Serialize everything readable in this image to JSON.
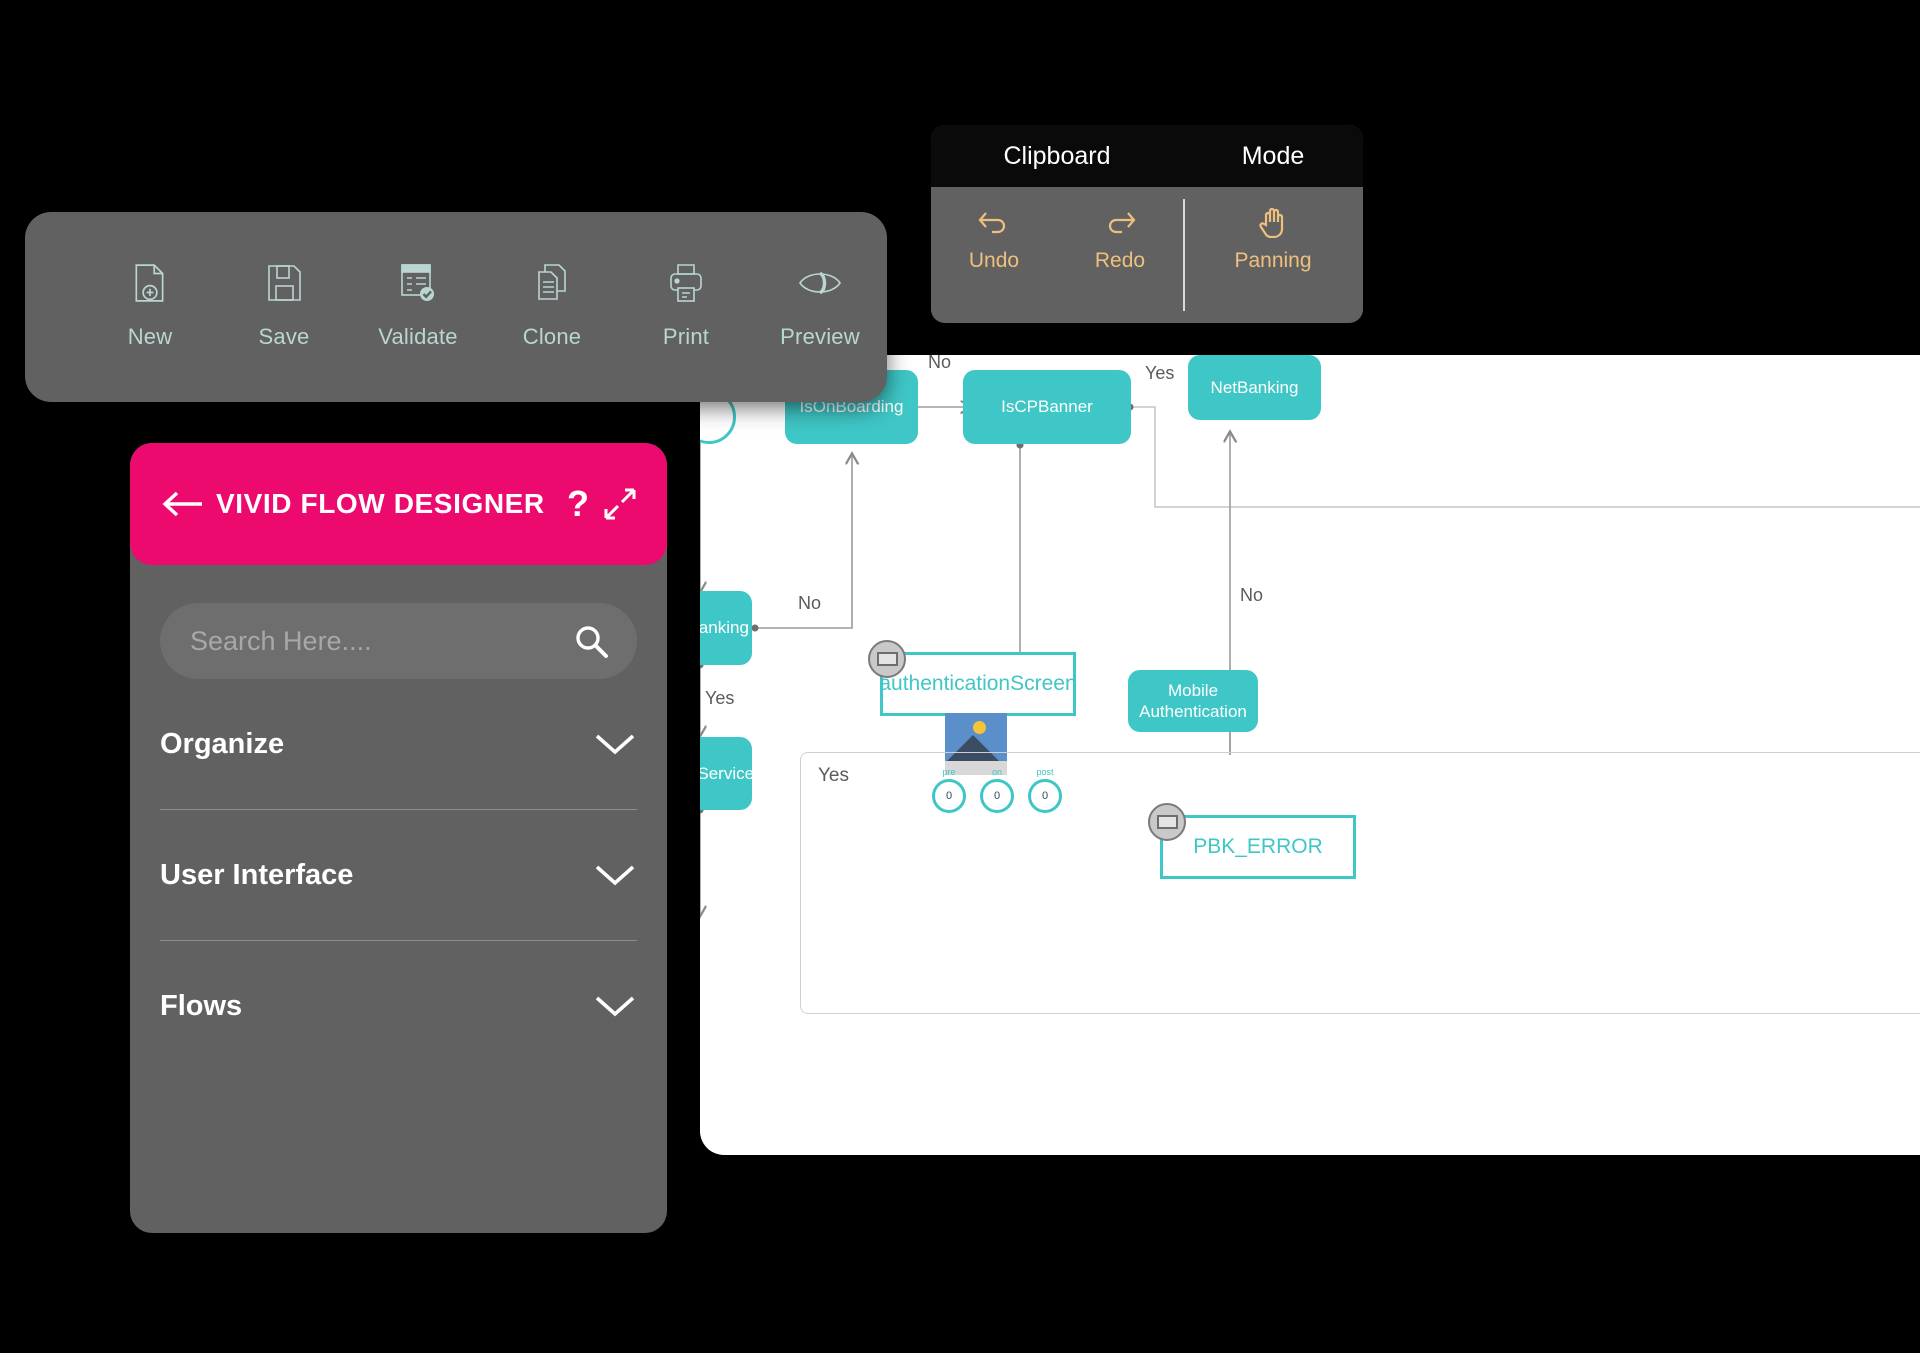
{
  "toolbar": {
    "items": [
      {
        "label": "New",
        "icon": "new-file-icon"
      },
      {
        "label": "Save",
        "icon": "floppy-disk-icon"
      },
      {
        "label": "Validate",
        "icon": "validate-document-icon"
      },
      {
        "label": "Clone",
        "icon": "copy-pages-icon"
      },
      {
        "label": "Print",
        "icon": "printer-icon"
      },
      {
        "label": "Preview",
        "icon": "eye-icon"
      }
    ],
    "icon_color": "#b9d6d2",
    "background": "#616161"
  },
  "clipboard_panel": {
    "groups": [
      {
        "title": "Clipboard"
      },
      {
        "title": "Mode"
      }
    ],
    "clipboard_actions": [
      {
        "label": "Undo",
        "icon": "undo-arrow-icon"
      },
      {
        "label": "Redo",
        "icon": "redo-arrow-icon"
      }
    ],
    "mode_actions": [
      {
        "label": "Panning",
        "icon": "hand-icon"
      }
    ],
    "accent": "#efc07d",
    "header_background": "#0a0a0a",
    "body_background": "#616161"
  },
  "sidebar": {
    "title": "VIVID FLOW DESIGNER",
    "back_icon": "back-arrow-icon",
    "help_icon": "question-mark-icon",
    "expand_icon": "expand-diagonal-icon",
    "header_color": "#ec0a6e",
    "search": {
      "placeholder": "Search Here....",
      "value": "",
      "icon": "search-icon"
    },
    "sections": [
      {
        "label": "Organize",
        "chevron": "chevron-down-icon"
      },
      {
        "label": "User Interface",
        "chevron": "chevron-down-icon"
      },
      {
        "label": "Flows",
        "chevron": "chevron-down-icon"
      }
    ]
  },
  "canvas": {
    "background": "#ffffff",
    "node_color": "#3fc6c6",
    "nodes": [
      {
        "id": "start",
        "label": "",
        "type": "start-circle"
      },
      {
        "id": "isphonebanking",
        "label": "IsPhoneBanking",
        "type": "process"
      },
      {
        "id": "errorfromservice",
        "label": "ErrorFromService",
        "type": "process"
      },
      {
        "id": "isonboarding",
        "label": "IsOnBoarding",
        "type": "process"
      },
      {
        "id": "iscpbanner",
        "label": "IsCPBanner",
        "type": "process"
      },
      {
        "id": "netbanking",
        "label": "NetBanking",
        "type": "process"
      },
      {
        "id": "mobileauth",
        "label": "Mobile Authentication",
        "type": "process"
      },
      {
        "id": "authscreen",
        "label": "authenticationScreen",
        "type": "screen"
      },
      {
        "id": "pbkerror",
        "label": "PBK_ERROR",
        "type": "screen"
      }
    ],
    "edge_labels": [
      {
        "id": "e1",
        "text": "No"
      },
      {
        "id": "e2",
        "text": "Yes"
      },
      {
        "id": "e3",
        "text": "No"
      },
      {
        "id": "e4",
        "text": "Yes"
      },
      {
        "id": "e5",
        "text": "No"
      },
      {
        "id": "e6",
        "text": "Yes"
      }
    ],
    "hooks": [
      {
        "label": "pre",
        "value": "0"
      },
      {
        "label": "on",
        "value": "0"
      },
      {
        "label": "post",
        "value": "0"
      }
    ],
    "thumbnail_icon": "image-thumbnail-icon",
    "collapse_icon": "collapse-badge-icon"
  }
}
